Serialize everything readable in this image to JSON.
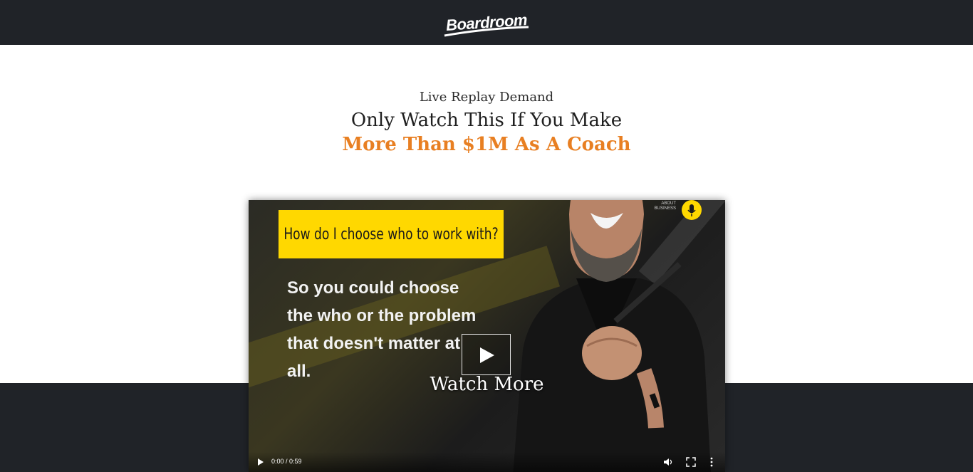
{
  "header": {
    "logo_text": "Boardroom"
  },
  "hero": {
    "kicker": "Live Replay Demand",
    "title_line1": "Only Watch This If You Make",
    "title_line2": "More Than $1M As A Coach"
  },
  "video": {
    "question": "How do I choose who to work with?",
    "quote": "So you could choose the who or the problem that doesn't matter at all.",
    "badge_text": "ABOUT BUSINESS",
    "overlay_label": "Watch More",
    "time": "0:00 / 0:59",
    "progress": 0
  },
  "colors": {
    "bar_background": "#202328",
    "accent_orange": "#e87f22",
    "highlight_yellow": "#ffd800"
  },
  "icons": [
    "logo-swoosh",
    "play-icon",
    "volume-icon",
    "fullscreen-icon",
    "more-options-icon"
  ]
}
